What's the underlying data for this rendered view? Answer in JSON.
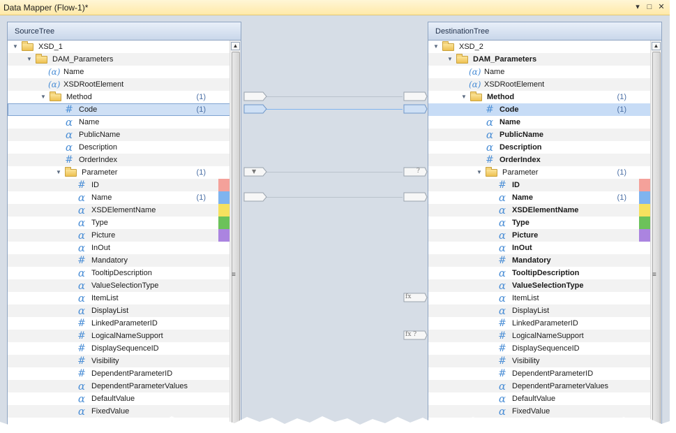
{
  "window": {
    "title": "Data Mapper (Flow-1)*",
    "controls": [
      "▾",
      "□",
      "✕"
    ]
  },
  "source_tree": {
    "header": "SourceTree",
    "rows": [
      {
        "label": "XSD_1",
        "icon": "folder",
        "level": 0,
        "expander": true
      },
      {
        "label": "DAM_Parameters",
        "icon": "folder",
        "level": 1,
        "expander": true
      },
      {
        "label": "Name",
        "icon": "attribute",
        "level": 2
      },
      {
        "label": "XSDRootElement",
        "icon": "attribute",
        "level": 2
      },
      {
        "label": "Method",
        "icon": "folder",
        "level": 2,
        "expander": true,
        "count": "(1)"
      },
      {
        "label": "Code",
        "icon": "hash",
        "level": 3,
        "count": "(1)",
        "selected": true
      },
      {
        "label": "Name",
        "icon": "alpha",
        "level": 3
      },
      {
        "label": "PublicName",
        "icon": "alpha",
        "level": 3
      },
      {
        "label": "Description",
        "icon": "alpha",
        "level": 3
      },
      {
        "label": "OrderIndex",
        "icon": "hash",
        "level": 3
      },
      {
        "label": "Parameter",
        "icon": "folder",
        "level": 3,
        "expander": true,
        "count": "(1)"
      },
      {
        "label": "ID",
        "icon": "hash",
        "level": 4,
        "swatch": "#f4a19a"
      },
      {
        "label": "Name",
        "icon": "alpha",
        "level": 4,
        "count": "(1)",
        "swatch": "#7fb4ef"
      },
      {
        "label": "XSDElementName",
        "icon": "alpha",
        "level": 4,
        "swatch": "#f6e15f"
      },
      {
        "label": "Type",
        "icon": "alpha",
        "level": 4,
        "swatch": "#6cc25a"
      },
      {
        "label": "Picture",
        "icon": "alpha",
        "level": 4,
        "swatch": "#ab84e0"
      },
      {
        "label": "InOut",
        "icon": "alpha",
        "level": 4
      },
      {
        "label": "Mandatory",
        "icon": "hash",
        "level": 4
      },
      {
        "label": "TooltipDescription",
        "icon": "alpha",
        "level": 4
      },
      {
        "label": "ValueSelectionType",
        "icon": "alpha",
        "level": 4
      },
      {
        "label": "ItemList",
        "icon": "alpha",
        "level": 4
      },
      {
        "label": "DisplayList",
        "icon": "alpha",
        "level": 4
      },
      {
        "label": "LinkedParameterID",
        "icon": "hash",
        "level": 4
      },
      {
        "label": "LogicalNameSupport",
        "icon": "hash",
        "level": 4
      },
      {
        "label": "DisplaySequenceID",
        "icon": "hash",
        "level": 4
      },
      {
        "label": "Visibility",
        "icon": "hash",
        "level": 4
      },
      {
        "label": "DependentParameterID",
        "icon": "hash",
        "level": 4
      },
      {
        "label": "DependentParameterValues",
        "icon": "alpha",
        "level": 4
      },
      {
        "label": "DefaultValue",
        "icon": "alpha",
        "level": 4
      },
      {
        "label": "FixedValue",
        "icon": "alpha",
        "level": 4
      }
    ]
  },
  "destination_tree": {
    "header": "DestinationTree",
    "rows": [
      {
        "label": "XSD_2",
        "icon": "folder",
        "level": 0,
        "expander": true
      },
      {
        "label": "DAM_Parameters",
        "icon": "folder",
        "level": 1,
        "expander": true,
        "bold": true
      },
      {
        "label": "Name",
        "icon": "attribute",
        "level": 2
      },
      {
        "label": "XSDRootElement",
        "icon": "attribute",
        "level": 2
      },
      {
        "label": "Method",
        "icon": "folder",
        "level": 2,
        "expander": true,
        "count": "(1)",
        "bold": true
      },
      {
        "label": "Code",
        "icon": "hash",
        "level": 3,
        "count": "(1)",
        "selected": true,
        "bold": true
      },
      {
        "label": "Name",
        "icon": "alpha",
        "level": 3,
        "bold": true
      },
      {
        "label": "PublicName",
        "icon": "alpha",
        "level": 3,
        "bold": true
      },
      {
        "label": "Description",
        "icon": "alpha",
        "level": 3,
        "bold": true
      },
      {
        "label": "OrderIndex",
        "icon": "hash",
        "level": 3,
        "bold": true
      },
      {
        "label": "Parameter",
        "icon": "folder",
        "level": 3,
        "expander": true,
        "count": "(1)"
      },
      {
        "label": "ID",
        "icon": "hash",
        "level": 4,
        "swatch": "#f4a19a",
        "bold": true
      },
      {
        "label": "Name",
        "icon": "alpha",
        "level": 4,
        "count": "(1)",
        "swatch": "#7fb4ef",
        "bold": true
      },
      {
        "label": "XSDElementName",
        "icon": "alpha",
        "level": 4,
        "swatch": "#f6e15f",
        "bold": true
      },
      {
        "label": "Type",
        "icon": "alpha",
        "level": 4,
        "swatch": "#6cc25a",
        "bold": true
      },
      {
        "label": "Picture",
        "icon": "alpha",
        "level": 4,
        "swatch": "#ab84e0",
        "bold": true
      },
      {
        "label": "InOut",
        "icon": "alpha",
        "level": 4,
        "bold": true
      },
      {
        "label": "Mandatory",
        "icon": "hash",
        "level": 4,
        "bold": true
      },
      {
        "label": "TooltipDescription",
        "icon": "alpha",
        "level": 4,
        "bold": true
      },
      {
        "label": "ValueSelectionType",
        "icon": "alpha",
        "level": 4,
        "bold": true
      },
      {
        "label": "ItemList",
        "icon": "alpha",
        "level": 4
      },
      {
        "label": "DisplayList",
        "icon": "alpha",
        "level": 4
      },
      {
        "label": "LinkedParameterID",
        "icon": "hash",
        "level": 4
      },
      {
        "label": "LogicalNameSupport",
        "icon": "hash",
        "level": 4
      },
      {
        "label": "DisplaySequenceID",
        "icon": "hash",
        "level": 4
      },
      {
        "label": "Visibility",
        "icon": "hash",
        "level": 4
      },
      {
        "label": "DependentParameterID",
        "icon": "hash",
        "level": 4
      },
      {
        "label": "DependentParameterValues",
        "icon": "alpha",
        "level": 4
      },
      {
        "label": "DefaultValue",
        "icon": "alpha",
        "level": 4
      },
      {
        "label": "FixedValue",
        "icon": "alpha",
        "level": 4
      }
    ]
  },
  "mappings": [
    {
      "from_row": 4,
      "to_row": 4,
      "kind": "plain",
      "selected": false
    },
    {
      "from_row": 5,
      "to_row": 5,
      "kind": "plain",
      "selected": true
    },
    {
      "from_row": 10,
      "to_row": 10,
      "kind": "filter",
      "dest_label": "?"
    },
    {
      "from_row": 12,
      "to_row": 12,
      "kind": "plain",
      "selected": false
    }
  ],
  "dest_functions": [
    {
      "row": 20,
      "label": "fx"
    },
    {
      "row": 23,
      "label": "fx ?"
    }
  ],
  "colors": {
    "selection": "#cfe0f5",
    "link_selected": "#7fb4ef",
    "icon_blue": "#4c8fd6",
    "canvas": "#d6dde6"
  }
}
